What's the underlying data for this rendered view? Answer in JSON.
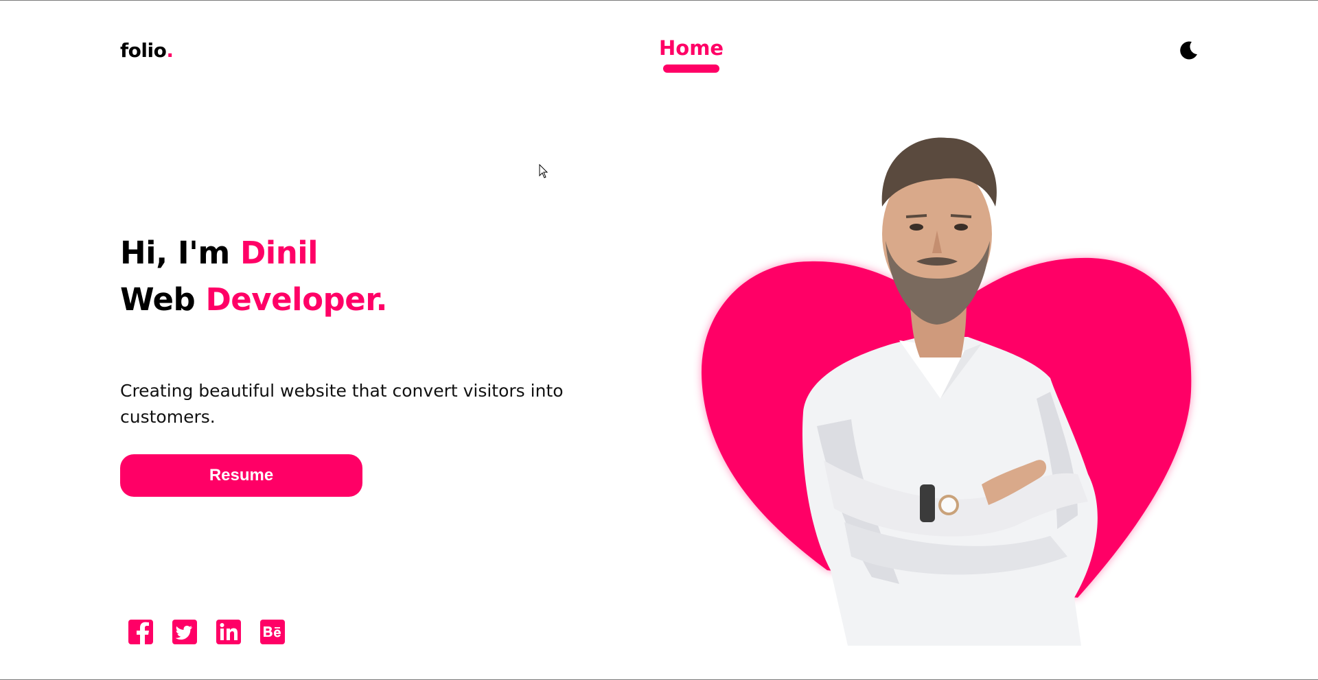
{
  "header": {
    "logo_text": "folio",
    "logo_dot": ".",
    "nav_home": "Home",
    "theme_toggle_icon": "moon-icon"
  },
  "hero": {
    "greeting": "Hi, I'm ",
    "name": "Dinil",
    "role_plain": "Web ",
    "role_accent": "Developer.",
    "subtitle": "Creating beautiful website that convert visitors into customers.",
    "resume_label": "Resume",
    "portrait_icon": "portrait-image"
  },
  "socials": [
    {
      "icon": "facebook-icon"
    },
    {
      "icon": "twitter-icon"
    },
    {
      "icon": "linkedin-icon"
    },
    {
      "icon": "behance-icon"
    }
  ],
  "colors": {
    "accent": "#ff0066",
    "text": "#000000",
    "background": "#ffffff"
  }
}
